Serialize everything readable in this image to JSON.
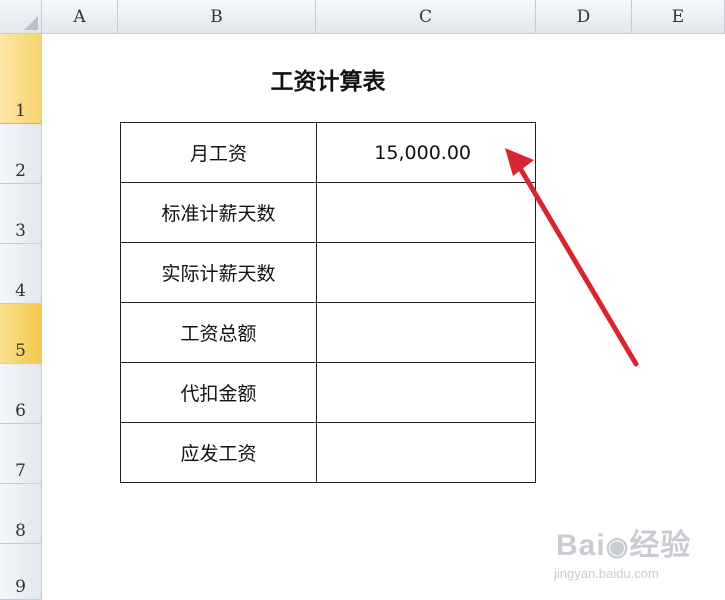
{
  "columns": [
    "A",
    "B",
    "C",
    "D",
    "E"
  ],
  "rows": [
    "1",
    "2",
    "3",
    "4",
    "5",
    "6",
    "7",
    "8",
    "9"
  ],
  "sheet": {
    "title": "工资计算表",
    "table": [
      {
        "label": "月工资",
        "value": "15,000.00"
      },
      {
        "label": "标准计薪天数",
        "value": ""
      },
      {
        "label": "实际计薪天数",
        "value": ""
      },
      {
        "label": "工资总额",
        "value": ""
      },
      {
        "label": "代扣金额",
        "value": ""
      },
      {
        "label": "应发工资",
        "value": ""
      }
    ]
  },
  "selection": {
    "active_row": "5"
  },
  "colors": {
    "arrow": "#d9262e",
    "selected_row_header": "#f7d46d"
  },
  "watermark": {
    "logo": "Bai 经验",
    "url": "jingyan.baidu.com"
  }
}
